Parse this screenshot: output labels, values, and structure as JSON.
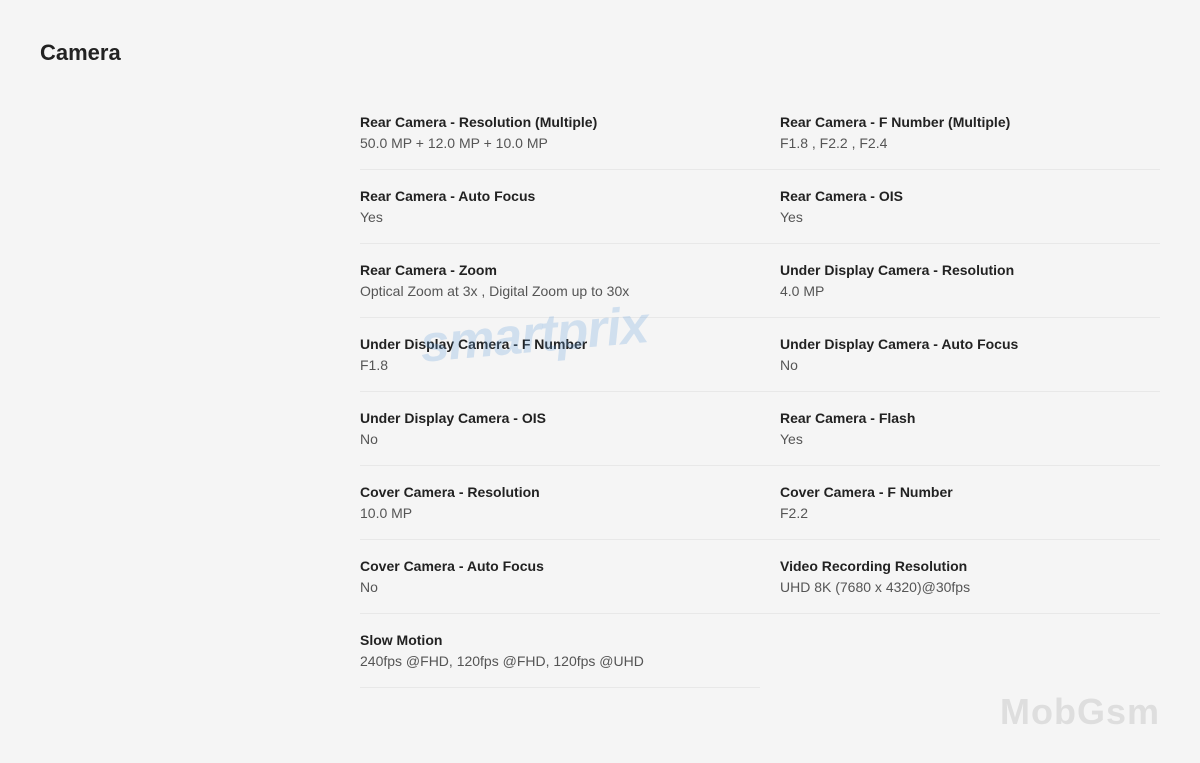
{
  "section": {
    "title": "Camera"
  },
  "watermarks": {
    "smartprix": "smartprix",
    "mobgsm": "MobGsm"
  },
  "specs": [
    {
      "label": "Rear Camera - Resolution (Multiple)",
      "value": "50.0 MP + 12.0 MP + 10.0 MP"
    },
    {
      "label": "Rear Camera - F Number (Multiple)",
      "value": "F1.8 , F2.2 , F2.4"
    },
    {
      "label": "Rear Camera - Auto Focus",
      "value": "Yes"
    },
    {
      "label": "Rear Camera - OIS",
      "value": "Yes"
    },
    {
      "label": "Rear Camera - Zoom",
      "value": "Optical Zoom at 3x , Digital Zoom up to 30x"
    },
    {
      "label": "Under Display Camera - Resolution",
      "value": "4.0 MP"
    },
    {
      "label": "Under Display Camera - F Number",
      "value": "F1.8"
    },
    {
      "label": "Under Display Camera - Auto Focus",
      "value": "No"
    },
    {
      "label": "Under Display Camera - OIS",
      "value": "No"
    },
    {
      "label": "Rear Camera - Flash",
      "value": "Yes"
    },
    {
      "label": "Cover Camera - Resolution",
      "value": "10.0 MP"
    },
    {
      "label": "Cover Camera - F Number",
      "value": "F2.2"
    },
    {
      "label": "Cover Camera - Auto Focus",
      "value": "No"
    },
    {
      "label": "Video Recording Resolution",
      "value": "UHD 8K (7680 x 4320)@30fps"
    },
    {
      "label": "Slow Motion",
      "value": "240fps @FHD, 120fps @FHD, 120fps @UHD"
    }
  ]
}
